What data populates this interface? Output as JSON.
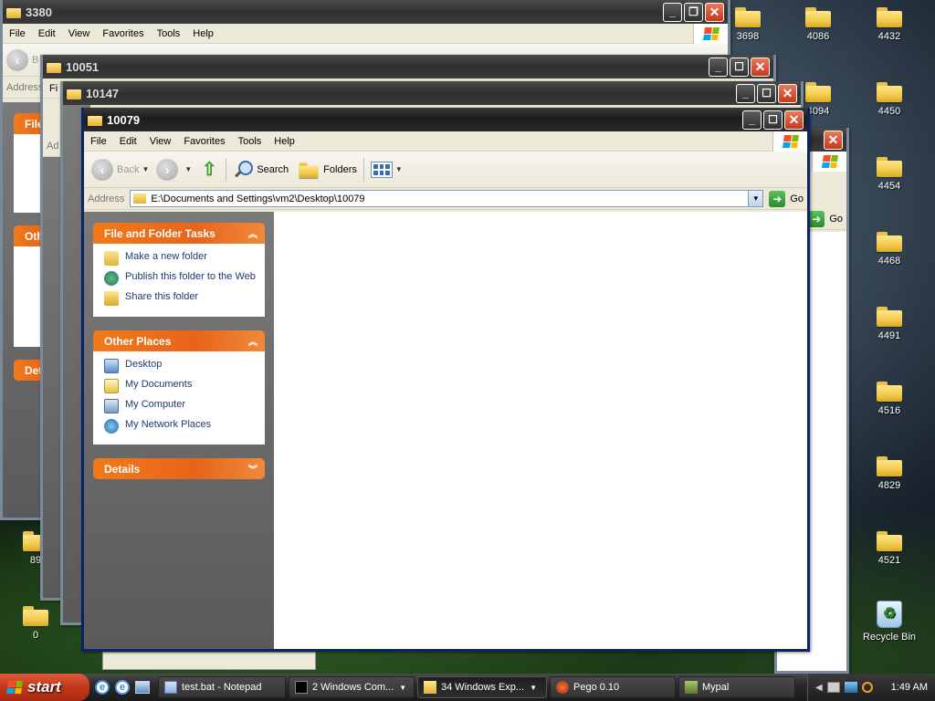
{
  "desktop": {
    "icons": [
      {
        "label": "3698"
      },
      {
        "label": "4086"
      },
      {
        "label": "4432"
      },
      {
        "label": "4094"
      },
      {
        "label": "4450"
      },
      {
        "label": "4454"
      },
      {
        "label": "4468"
      },
      {
        "label": "4491"
      },
      {
        "label": "4516"
      },
      {
        "label": "4829"
      },
      {
        "label": "4521"
      },
      {
        "label": "89"
      },
      {
        "label": "0"
      },
      {
        "label": "Recycle Bin"
      }
    ]
  },
  "bg_windows": {
    "w3380": {
      "title": "3380",
      "menu": [
        "File",
        "Edit",
        "View",
        "Favorites",
        "Tools",
        "Help"
      ],
      "address_label": "Address",
      "back_fragment": "B",
      "sidebar_heads": [
        "File",
        "Oth",
        "Det"
      ]
    },
    "w10051": {
      "title": "10051",
      "address_fragment": "Ad",
      "menu_fragment": "Fi"
    },
    "w10147": {
      "title": "10147"
    },
    "w4094": {
      "title_fragment": "094",
      "go_label": "Go"
    }
  },
  "window": {
    "title": "10079",
    "menu": [
      "File",
      "Edit",
      "View",
      "Favorites",
      "Tools",
      "Help"
    ],
    "toolbar": {
      "back": "Back",
      "search": "Search",
      "folders": "Folders"
    },
    "address": {
      "label": "Address",
      "value": "E:\\Documents and Settings\\vm2\\Desktop\\10079",
      "go": "Go"
    },
    "tasks": {
      "file_folder": {
        "title": "File and Folder Tasks",
        "items": [
          "Make a new folder",
          "Publish this folder to the Web",
          "Share this folder"
        ]
      },
      "other_places": {
        "title": "Other Places",
        "items": [
          "Desktop",
          "My Documents",
          "My Computer",
          "My Network Places"
        ]
      },
      "details": {
        "title": "Details"
      }
    }
  },
  "taskbar": {
    "start": "start",
    "buttons": [
      {
        "label": "test.bat - Notepad"
      },
      {
        "label": "2 Windows Com..."
      },
      {
        "label": "34 Windows Exp..."
      },
      {
        "label": "Pego 0.10"
      },
      {
        "label": "Mypal"
      }
    ],
    "clock": "1:49 AM"
  },
  "colors": {
    "task_header": "#e8641a",
    "title_active": "#1c1c1c",
    "link_blue": "#1c3a6e",
    "close_red": "#c9381a"
  }
}
